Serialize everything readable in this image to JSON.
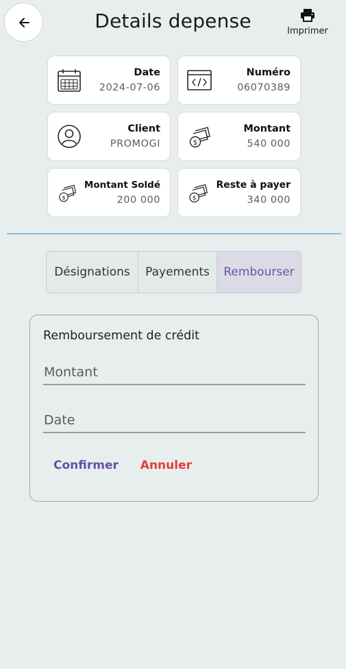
{
  "header": {
    "title": "Details depense",
    "print_label": "Imprimer"
  },
  "cards": {
    "date": {
      "label": "Date",
      "value": "2024-07-06"
    },
    "numero": {
      "label": "Numéro",
      "value": "06070389"
    },
    "client": {
      "label": "Client",
      "value": "PROMOGI"
    },
    "montant": {
      "label": "Montant",
      "value": "540 000"
    },
    "montant_solde": {
      "label": "Montant Soldé",
      "value": "200 000"
    },
    "reste": {
      "label": "Reste à payer",
      "value": "340 000"
    }
  },
  "tabs": [
    "Désignations",
    "Payements",
    "Rembourser"
  ],
  "active_tab": "Rembourser",
  "form": {
    "title": "Remboursement de crédit",
    "montant_placeholder": "Montant",
    "date_placeholder": "Date",
    "confirm_label": "Confirmer",
    "cancel_label": "Annuler"
  },
  "colors": {
    "accent": "#6650a8",
    "danger": "#e0403a",
    "divider": "#86bde9",
    "background": "#e8eeed"
  }
}
